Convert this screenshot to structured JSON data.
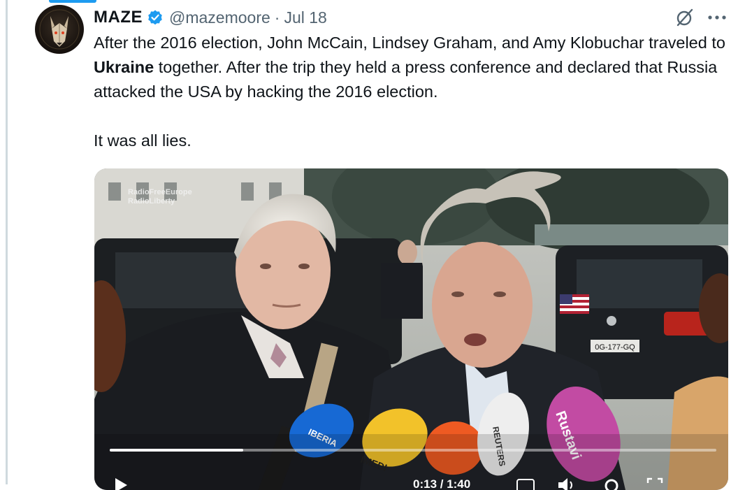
{
  "tweet": {
    "author_name": "MAZE",
    "handle": "@mazemoore",
    "separator": "·",
    "date": "Jul 18",
    "text_line1_pre": "After the 2016 election, John McCain, Lindsey Graham, and Amy Klobuchar traveled to ",
    "text_bold": "Ukraine",
    "text_line1_post": " together. After the trip they held a press conference and declared that Russia attacked the USA by hacking the 2016 election.",
    "text_line2": "It was all lies.",
    "verified_badge_icon": "verified-badge-icon",
    "grok_icon": "grok-icon",
    "more_icon": "more-icon"
  },
  "media": {
    "watermark_line1": "RadioFreeEurope",
    "watermark_line2": "RadioLiberty",
    "license_plate": "0G-177-GQ",
    "mic_labels": [
      "IBERIA",
      "IMEDI",
      "REUTERS",
      "Rustavi"
    ],
    "time_display": "0:13 / 1:40",
    "progress": 0.22,
    "icons": [
      "play-icon",
      "captions-icon",
      "volume-icon",
      "settings-icon",
      "fullscreen-icon"
    ]
  },
  "colors": {
    "accent": "#1d9bf0",
    "text": "#0f1419",
    "secondary": "#536471"
  }
}
